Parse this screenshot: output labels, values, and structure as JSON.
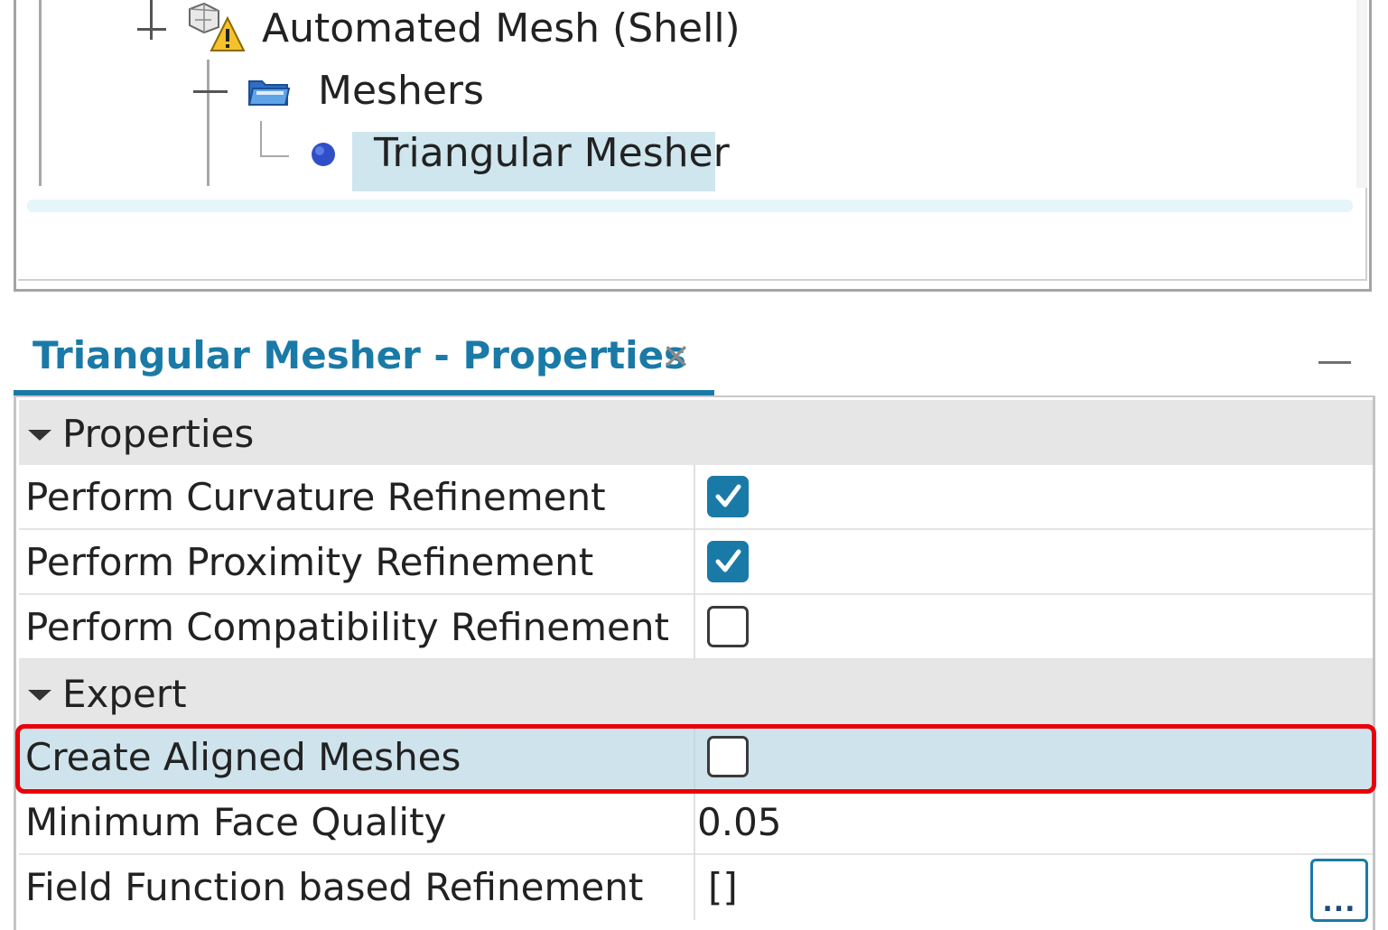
{
  "tree": {
    "items": [
      {
        "label": "Automated Mesh (Shell)",
        "icon": "mesh-operation-warning-icon"
      },
      {
        "label": "Meshers",
        "icon": "folder-icon"
      },
      {
        "label": "Triangular Mesher",
        "icon": "blue-dot-icon",
        "selected": true
      }
    ]
  },
  "properties_panel": {
    "title": "Triangular Mesher - Properties",
    "close_glyph": "×",
    "groups": [
      {
        "label": "Properties",
        "rows": [
          {
            "name": "Perform Curvature Refinement",
            "checked": true
          },
          {
            "name": "Perform Proximity Refinement",
            "checked": true
          },
          {
            "name": "Perform Compatibility Refinement",
            "checked": false
          }
        ]
      },
      {
        "label": "Expert",
        "rows": [
          {
            "name": "Create Aligned Meshes",
            "checked": false,
            "selected": true
          },
          {
            "name": "Minimum Face Quality",
            "value": "0.05"
          },
          {
            "name": "Field Function based Refinement",
            "value": "[]",
            "button": "..."
          }
        ]
      }
    ]
  },
  "colors": {
    "accent": "#1a7aa7",
    "highlight_outline": "#e8000b",
    "selected_row": "#cfe3ec",
    "group_header": "#e6e6e6"
  }
}
